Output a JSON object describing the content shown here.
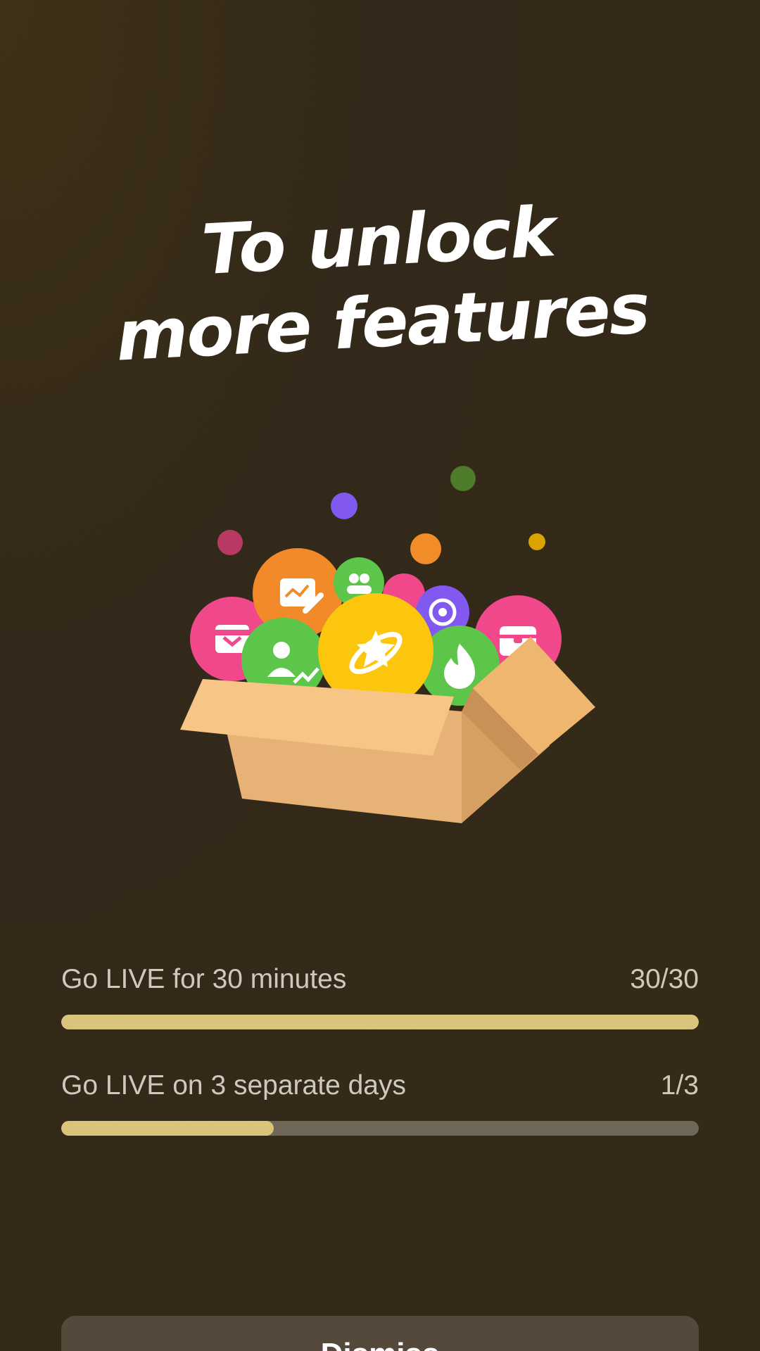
{
  "headline": {
    "line1": "To unlock",
    "line2": "more features"
  },
  "illustration": {
    "icons": [
      "gift-icon",
      "analytics-edit-icon",
      "group-icon",
      "target-icon",
      "treasure-chest-icon",
      "growth-person-icon",
      "star-planet-icon",
      "flame-icon"
    ]
  },
  "tasks": [
    {
      "label": "Go LIVE for 30 minutes",
      "count": "30/30",
      "progress": 1.0
    },
    {
      "label": "Go LIVE on 3 separate days",
      "count": "1/3",
      "progress": 0.3333
    }
  ],
  "bottom_button": {
    "label": "Dismiss"
  },
  "colors": {
    "background": "#352a17",
    "progress_fill": "#d8c47a",
    "progress_track": "#6f6757",
    "text_secondary": "#cfc9bd"
  }
}
